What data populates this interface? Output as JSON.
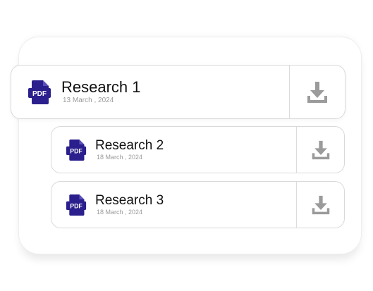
{
  "colors": {
    "pdf_icon": "#2a1f8c",
    "download_icon": "#9b9b9b",
    "card_border": "#d9d9d9",
    "title_text": "#111111",
    "date_text": "#9a9a9a"
  },
  "files": [
    {
      "icon": "pdf-icon",
      "title": "Research 1",
      "date": "13 March , 2024",
      "action_icon": "download-icon"
    },
    {
      "icon": "pdf-icon",
      "title": "Research 2",
      "date": "18 March , 2024",
      "action_icon": "download-icon"
    },
    {
      "icon": "pdf-icon",
      "title": "Research 3",
      "date": "18 March , 2024",
      "action_icon": "download-icon"
    }
  ]
}
